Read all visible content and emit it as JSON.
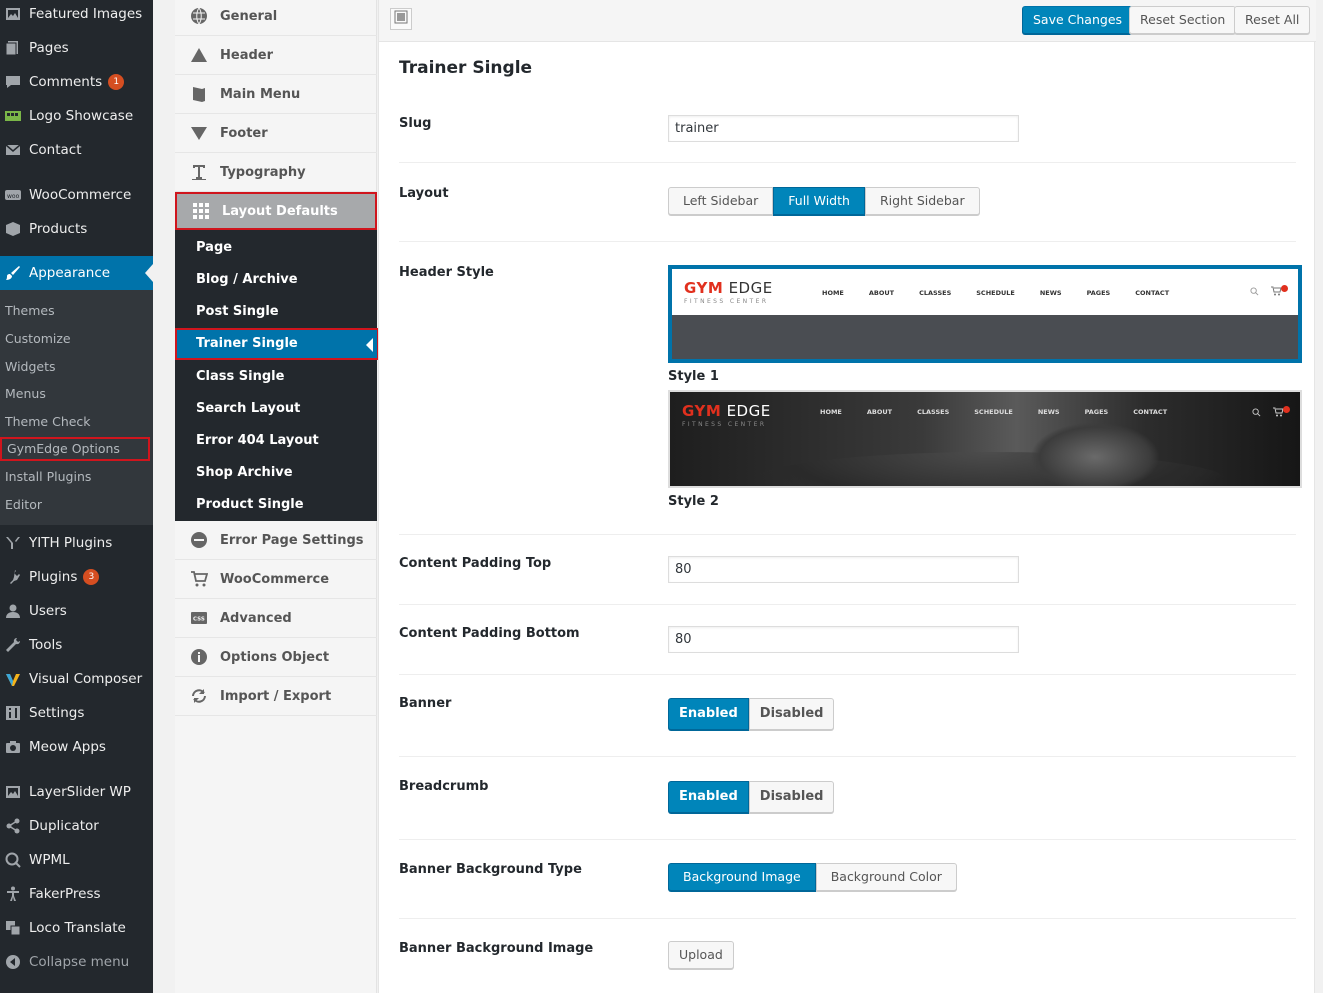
{
  "wp_menu": {
    "items": [
      {
        "label": "Featured Images",
        "icon": "featured-images-icon"
      },
      {
        "label": "Pages",
        "icon": "pages-icon"
      },
      {
        "label": "Comments",
        "icon": "comments-icon",
        "badge": "1"
      },
      {
        "label": "Logo Showcase",
        "icon": "logo-showcase-icon"
      },
      {
        "label": "Contact",
        "icon": "contact-icon"
      },
      {
        "label": "WooCommerce",
        "icon": "woocommerce-icon"
      },
      {
        "label": "Products",
        "icon": "products-icon"
      },
      {
        "label": "Appearance",
        "icon": "appearance-icon",
        "active": true
      }
    ],
    "appearance_sub": [
      "Themes",
      "Customize",
      "Widgets",
      "Menus",
      "Theme Check",
      "GymEdge Options",
      "Install Plugins",
      "Editor"
    ],
    "lower_items": [
      {
        "label": "YITH Plugins",
        "icon": "yith-icon"
      },
      {
        "label": "Plugins",
        "icon": "plugins-icon",
        "badge": "3"
      },
      {
        "label": "Users",
        "icon": "users-icon"
      },
      {
        "label": "Tools",
        "icon": "tools-icon"
      },
      {
        "label": "Visual Composer",
        "icon": "visual-composer-icon"
      },
      {
        "label": "Settings",
        "icon": "settings-icon"
      },
      {
        "label": "Meow Apps",
        "icon": "camera-icon"
      },
      {
        "label": "LayerSlider WP",
        "icon": "layerslider-icon"
      },
      {
        "label": "Duplicator",
        "icon": "duplicator-icon"
      },
      {
        "label": "WPML",
        "icon": "wpml-icon"
      },
      {
        "label": "FakerPress",
        "icon": "fakerpress-icon"
      },
      {
        "label": "Loco Translate",
        "icon": "loco-translate-icon"
      },
      {
        "label": "Collapse menu",
        "icon": "collapse-icon"
      }
    ]
  },
  "options_nav": {
    "items": [
      {
        "label": "General"
      },
      {
        "label": "Header"
      },
      {
        "label": "Main Menu"
      },
      {
        "label": "Footer"
      },
      {
        "label": "Typography"
      },
      {
        "label": "Layout Defaults"
      }
    ],
    "layout_sub": [
      "Page",
      "Blog / Archive",
      "Post Single",
      "Trainer Single",
      "Class Single",
      "Search Layout",
      "Error 404 Layout",
      "Shop Archive",
      "Product Single"
    ],
    "lower_items": [
      {
        "label": "Error Page Settings"
      },
      {
        "label": "WooCommerce"
      },
      {
        "label": "Advanced"
      },
      {
        "label": "Options Object"
      },
      {
        "label": "Import / Export"
      }
    ]
  },
  "toolbar": {
    "save_label": "Save Changes",
    "reset_section_label": "Reset Section",
    "reset_all_label": "Reset All"
  },
  "section": {
    "title": "Trainer Single",
    "slug_label": "Slug",
    "slug_value": "trainer",
    "layout_label": "Layout",
    "layout_options": [
      "Left Sidebar",
      "Full Width",
      "Right Sidebar"
    ],
    "layout_selected": "Full Width",
    "header_style_label": "Header Style",
    "header_styles": [
      {
        "caption": "Style 1",
        "selected": true
      },
      {
        "caption": "Style 2",
        "selected": false
      }
    ],
    "header_preview": {
      "logo_gym": "GYM",
      "logo_edge": "EDGE",
      "logo_sub": "FITNESS CENTER",
      "nav": [
        "HOME",
        "ABOUT",
        "CLASSES",
        "SCHEDULE",
        "NEWS",
        "PAGES",
        "CONTACT"
      ]
    },
    "padding_top_label": "Content Padding Top",
    "padding_top_value": "80",
    "padding_bottom_label": "Content Padding Bottom",
    "padding_bottom_value": "80",
    "banner_label": "Banner",
    "banner_options": [
      "Enabled",
      "Disabled"
    ],
    "breadcrumb_label": "Breadcrumb",
    "breadcrumb_options": [
      "Enabled",
      "Disabled"
    ],
    "banner_bg_type_label": "Banner Background Type",
    "banner_bg_type_options": [
      "Background Image",
      "Background Color"
    ],
    "banner_bg_image_label": "Banner Background Image",
    "upload_label": "Upload"
  },
  "colors": {
    "wp_sidebar": "#23282d",
    "accent": "#0073aa",
    "primary_button": "#0085ba",
    "highlight_border": "#d0151d",
    "badge": "#d54e21"
  }
}
